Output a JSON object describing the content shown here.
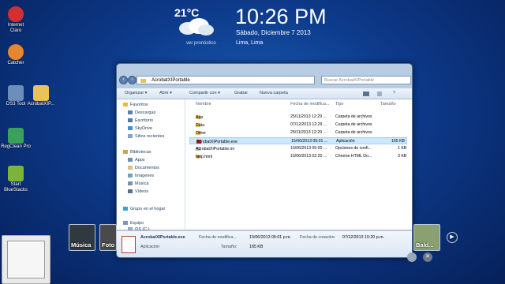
{
  "desktop": {
    "icons": [
      {
        "label": "Internet\nClaro",
        "name": "internet-claro",
        "color": "#d23030"
      },
      {
        "label": "Catcher",
        "name": "catcher",
        "color": "#e8862d"
      },
      {
        "label": "DS3 Tool",
        "name": "ds3-tool",
        "color": "#6b8fb8"
      },
      {
        "label": "AcrobatXIP...",
        "name": "acrobat-folder",
        "color": "#e8c35a"
      },
      {
        "label": "RegClean Pro",
        "name": "regclean-pro",
        "color": "#3aa05a"
      },
      {
        "label": "Start\nBlueStacks",
        "name": "bluestacks",
        "color": "#7ab53a"
      }
    ]
  },
  "weather": {
    "temp": "21°C",
    "link": "ver pronóstico"
  },
  "clock": {
    "time": "10:26 PM",
    "date": "Sábado, Diciembre 7 2013",
    "location": "Lima, Lima"
  },
  "explorer": {
    "address": "AcrobatXIPortable",
    "search_placeholder": "Buscar AcrobatXIPortable",
    "toolbar": {
      "organize": "Organizar ▾",
      "open": "Abrir ▾",
      "share": "Compartir con ▾",
      "burn": "Grabar",
      "new_folder": "Nueva carpeta"
    },
    "nav": {
      "favorites": "Favoritos",
      "fav_items": [
        "Descargas",
        "Escritorio",
        "SkyDrive",
        "Sitios recientes"
      ],
      "libraries": "Bibliotecas",
      "lib_items": [
        "Apps",
        "Documentos",
        "Imágenes",
        "Música",
        "Vídeos"
      ],
      "homegroup": "Grupo en el hogar",
      "computer": "Equipo",
      "computer_items": [
        "OS (C:)"
      ]
    },
    "columns": {
      "name": "Nombre",
      "date": "Fecha de modifica...",
      "type": "Tipo",
      "size": "Tamaño"
    },
    "files": [
      {
        "name": "App",
        "date": "25/11/2013 12:29 ...",
        "type": "Carpeta de archivos",
        "size": "",
        "kind": "folder"
      },
      {
        "name": "Data",
        "date": "07/12/2013 12:29 ...",
        "type": "Carpeta de archivos",
        "size": "",
        "kind": "folder"
      },
      {
        "name": "Other",
        "date": "25/11/2013 12:29 ...",
        "type": "Carpeta de archivos",
        "size": "",
        "kind": "folder"
      },
      {
        "name": "AcrobatXIPortable.exe",
        "date": "15/06/2013 05:01 ...",
        "type": "Aplicación",
        "size": "165 KB",
        "kind": "exe"
      },
      {
        "name": "AcrobatXIPortable.ini",
        "date": "15/06/2013 05:00 ...",
        "type": "Opciones de confi...",
        "size": "1 KB",
        "kind": "ini"
      },
      {
        "name": "help.html",
        "date": "15/06/2013 02:20 ...",
        "type": "Chrome HTML Do...",
        "size": "3 KB",
        "kind": "html"
      }
    ],
    "details": {
      "filename": "AcrobatXIPortable.exe",
      "kind": "Aplicación",
      "mod_label": "Fecha de modifica...",
      "mod_value": "15/06/2013 05:01 p.m.",
      "created_label": "Fecha de creación:",
      "created_value": "07/12/2013 10:20 p.m.",
      "size_label": "Tamaño:",
      "size_value": "165 KB"
    }
  },
  "media": {
    "thumbs": [
      "Música",
      "Foto",
      "Bald..."
    ]
  }
}
